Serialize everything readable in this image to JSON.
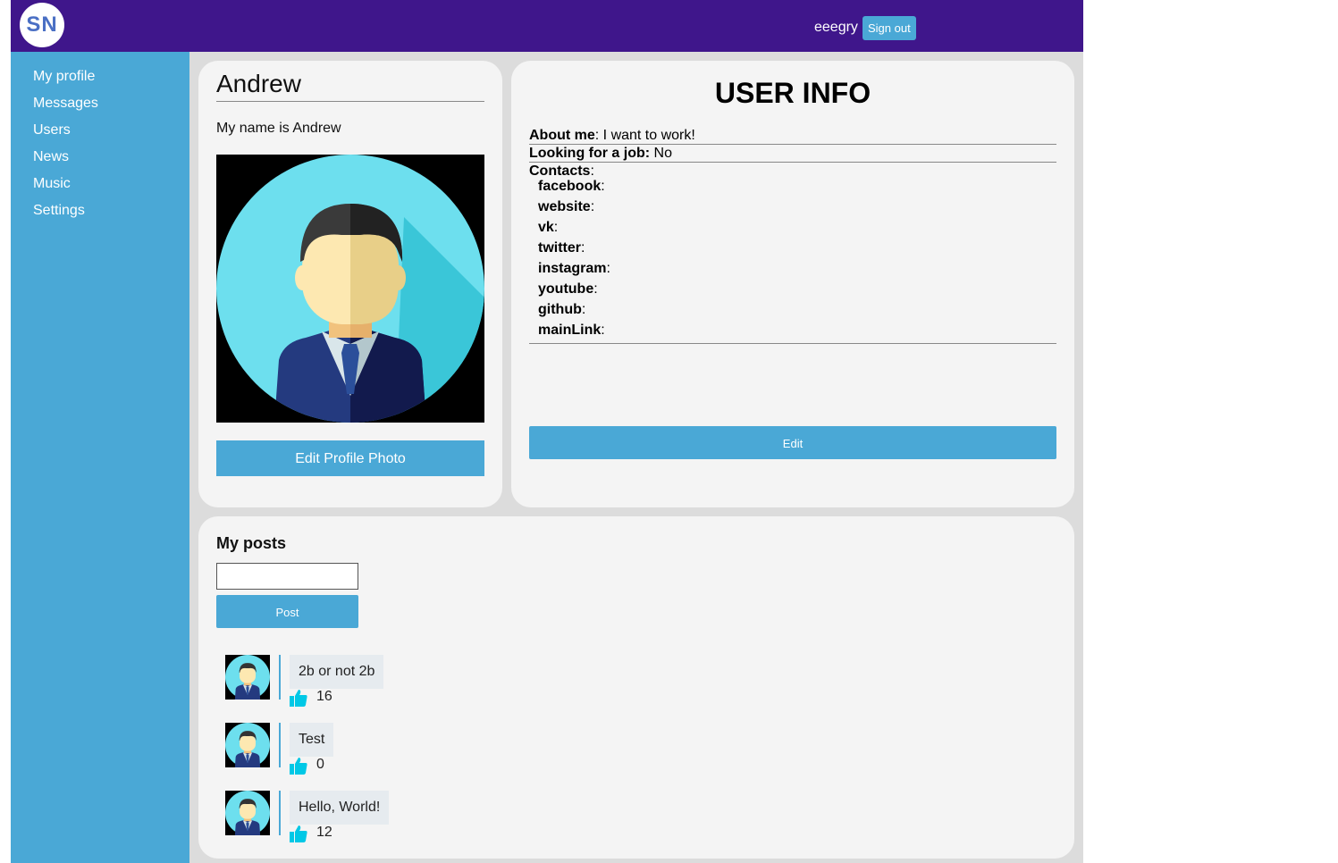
{
  "header": {
    "logo_text": "SN",
    "login_name": "eeegry",
    "signout_label": "Sign out"
  },
  "sidebar": {
    "items": [
      {
        "label": "My profile"
      },
      {
        "label": "Messages"
      },
      {
        "label": "Users"
      },
      {
        "label": "News"
      },
      {
        "label": "Music"
      },
      {
        "label": "Settings"
      }
    ]
  },
  "profile": {
    "name": "Andrew",
    "status": "My name is Andrew",
    "edit_photo_label": "Edit Profile Photo"
  },
  "user_info": {
    "title": "USER INFO",
    "about_label": "About me",
    "about_value": "I want to work!",
    "job_label": "Looking for a job:",
    "job_value": "No",
    "contacts_label": "Contacts",
    "contacts": [
      {
        "label": "facebook",
        "value": ""
      },
      {
        "label": "website",
        "value": ""
      },
      {
        "label": "vk",
        "value": ""
      },
      {
        "label": "twitter",
        "value": ""
      },
      {
        "label": "instagram",
        "value": ""
      },
      {
        "label": "youtube",
        "value": ""
      },
      {
        "label": "github",
        "value": ""
      },
      {
        "label": "mainLink",
        "value": ""
      }
    ],
    "edit_label": "Edit"
  },
  "posts": {
    "title": "My posts",
    "input_value": "",
    "post_button_label": "Post",
    "items": [
      {
        "text": "2b or not 2b",
        "likes": "16"
      },
      {
        "text": "Test",
        "likes": "0"
      },
      {
        "text": "Hello, World!",
        "likes": "12"
      }
    ]
  },
  "colors": {
    "header": "#3f168b",
    "sidebar": "#4aa8d6",
    "accent": "#4aa8d6",
    "like": "#00c8e6"
  }
}
